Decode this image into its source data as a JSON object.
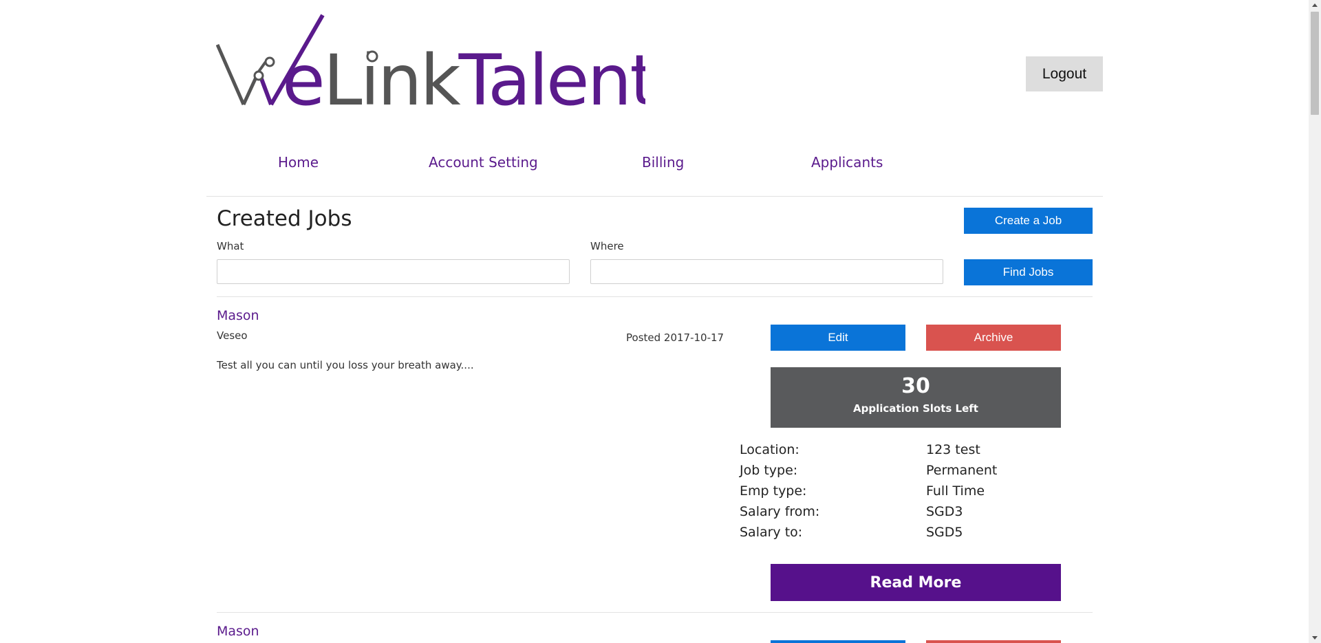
{
  "brand": {
    "logo_text": "WeLinkTalent",
    "purple": "#5a1a8c",
    "grey": "#555555"
  },
  "header": {
    "logout_label": "Logout"
  },
  "nav": {
    "items": [
      {
        "label": "Home"
      },
      {
        "label": "Account Setting"
      },
      {
        "label": "Billing"
      },
      {
        "label": "Applicants"
      }
    ]
  },
  "main": {
    "title": "Created Jobs",
    "create_label": "Create a Job",
    "find_label": "Find Jobs",
    "what": {
      "label": "What",
      "value": "",
      "placeholder": ""
    },
    "where": {
      "label": "Where",
      "value": "",
      "placeholder": ""
    }
  },
  "jobs": [
    {
      "title": "Mason",
      "company": "Veseo",
      "posted": "Posted 2017-10-17",
      "description": "Test all you can until you loss your breath away....",
      "edit_label": "Edit",
      "archive_label": "Archive",
      "slots_count": "30",
      "slots_label": "Application Slots Left",
      "details": [
        {
          "label": "Location:",
          "value": "123 test"
        },
        {
          "label": "Job type:",
          "value": "Permanent"
        },
        {
          "label": "Emp type:",
          "value": "Full Time"
        },
        {
          "label": "Salary from:",
          "value": "SGD3"
        },
        {
          "label": "Salary to:",
          "value": "SGD5"
        }
      ],
      "read_more_label": "Read More"
    },
    {
      "title": "Mason"
    }
  ],
  "colors": {
    "primary_blue": "#0a74d8",
    "danger_red": "#d9534f",
    "slots_grey": "#595a5c",
    "read_more_purple": "#56118b"
  }
}
